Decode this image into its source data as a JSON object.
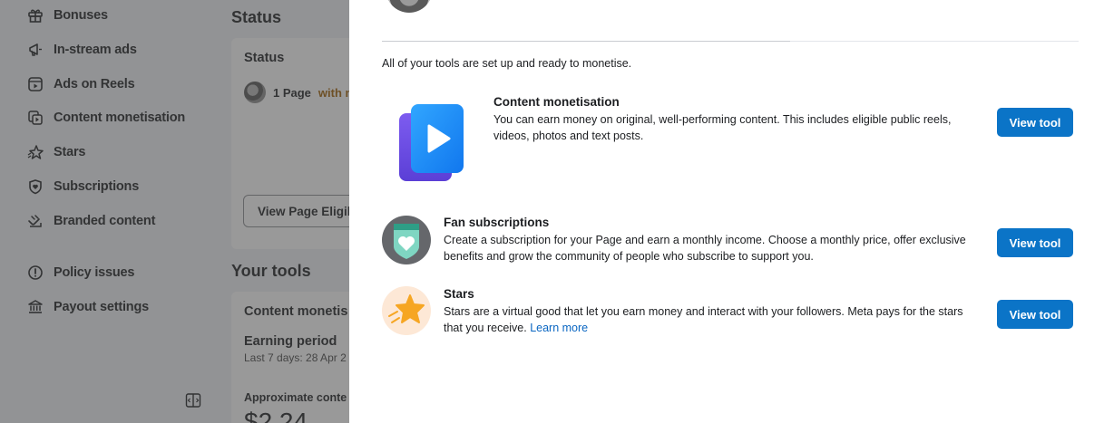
{
  "sidebar": {
    "items": [
      {
        "label": "Bonuses",
        "icon": "gift-icon"
      },
      {
        "label": "In-stream ads",
        "icon": "megaphone-icon"
      },
      {
        "label": "Ads on Reels",
        "icon": "reels-icon"
      },
      {
        "label": "Content monetisation",
        "icon": "content-monetisation-icon"
      },
      {
        "label": "Stars",
        "icon": "star-icon"
      },
      {
        "label": "Subscriptions",
        "icon": "subscriptions-shield-icon"
      },
      {
        "label": "Branded content",
        "icon": "handshake-icon"
      },
      {
        "label": "Policy issues",
        "icon": "alert-circle-icon"
      },
      {
        "label": "Payout settings",
        "icon": "bank-icon"
      }
    ]
  },
  "background": {
    "status_heading": "Status",
    "status_card_title": "Status",
    "page_count": "1 Page",
    "page_status": "with m",
    "eligibility_button": "View Page Eligibil",
    "tools_heading": "Your tools",
    "tools_card_title": "Content monetis",
    "earning_period_title": "Earning period",
    "earning_period_range": "Last 7 days: 28 Apr 2",
    "approx_label": "Approximate conte",
    "approx_value": "$2.24"
  },
  "panel": {
    "intro": "All of your tools are set up and ready to monetise.",
    "tools": [
      {
        "name": "Content monetisation",
        "description": "You can earn money on original, well-performing content. This includes eligible public reels, videos, photos and text posts.",
        "button": "View tool",
        "icon": "play-tiles-icon"
      },
      {
        "name": "Fan subscriptions",
        "description": "Create a subscription for your Page and earn a monthly income. Choose a monthly price, offer exclusive benefits and grow the community of people who subscribe to support you.",
        "button": "View tool",
        "icon": "heart-badge-icon"
      },
      {
        "name": "Stars",
        "description": "Stars are a virtual good that let you earn money and interact with your followers. Meta pays for the stars that you receive.",
        "link": "Learn more",
        "button": "View tool",
        "icon": "shooting-star-icon"
      }
    ]
  },
  "colors": {
    "primary_button": "#0b74c7",
    "link": "#0a66c2",
    "warning_text": "#a15e00"
  }
}
